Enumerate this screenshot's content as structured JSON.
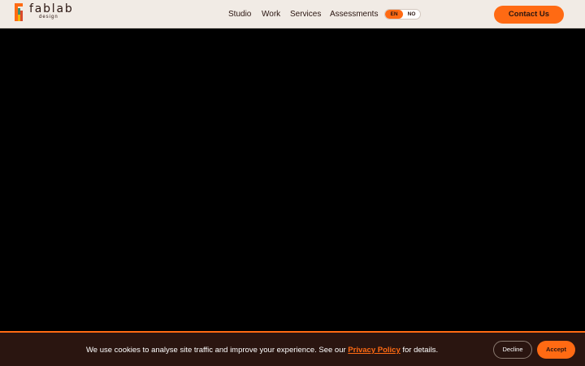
{
  "header": {
    "logo": {
      "word": "fablab",
      "sub": "design"
    },
    "nav": [
      "Studio",
      "Work",
      "Services",
      "Assessments"
    ],
    "lang": {
      "en": "EN",
      "no": "NO",
      "selected": "EN"
    },
    "contact_label": "Contact Us"
  },
  "cookie": {
    "text_before": "We use cookies to analyse site traffic and improve your experience. See our",
    "link_label": "Privacy Policy",
    "text_after": "for details.",
    "decline_label": "Decline",
    "accept_label": "Accept"
  },
  "colors": {
    "accent": "#ff6a13",
    "header_bg": "#f1ebe5",
    "banner_bg": "#2a1510",
    "text_dark": "#2a1510"
  }
}
